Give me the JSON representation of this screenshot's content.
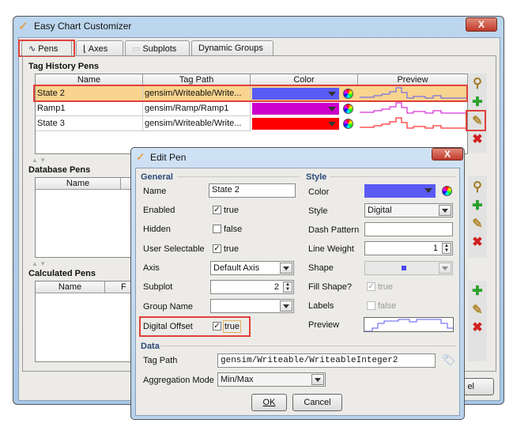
{
  "window": {
    "title": "Easy Chart Customizer",
    "close": "X"
  },
  "tabs": [
    {
      "label": "Pens",
      "icon": "line-chart-icon"
    },
    {
      "label": "Axes",
      "icon": "axes-icon"
    },
    {
      "label": "Subplots",
      "icon": "subplots-icon"
    },
    {
      "label": "Dynamic Groups"
    }
  ],
  "tag_history": {
    "title": "Tag History Pens",
    "columns": [
      "Name",
      "Tag Path",
      "Color",
      "Preview"
    ],
    "rows": [
      {
        "name": "State 2",
        "path": "gensim/Writeable/Write...",
        "color": "#5a5af5",
        "selected": true
      },
      {
        "name": "Ramp1",
        "path": "gensim/Ramp/Ramp1",
        "color": "#cc00cc"
      },
      {
        "name": "State 3",
        "path": "gensim/Writeable/Write...",
        "color": "#ff0000"
      }
    ]
  },
  "database": {
    "title": "Database Pens",
    "columns": [
      "Name"
    ]
  },
  "calculated": {
    "title": "Calculated Pens",
    "columns": [
      "Name",
      "F"
    ]
  },
  "main_cancel": "el",
  "dialog": {
    "title": "Edit Pen",
    "close": "X",
    "general": {
      "title": "General",
      "name_label": "Name",
      "name": "State 2",
      "enabled_label": "Enabled",
      "enabled": "true",
      "hidden_label": "Hidden",
      "hidden": "false",
      "selectable_label": "User Selectable",
      "selectable": "true",
      "axis_label": "Axis",
      "axis": "Default Axis",
      "subplot_label": "Subplot",
      "subplot": "2",
      "group_label": "Group Name",
      "group": "",
      "offset_label": "Digital Offset",
      "offset": "true"
    },
    "style": {
      "title": "Style",
      "color_label": "Color",
      "color": "#5a5af5",
      "style_label": "Style",
      "style": "Digital",
      "dash_label": "Dash Pattern",
      "dash": "",
      "weight_label": "Line Weight",
      "weight": "1",
      "shape_label": "Shape",
      "fill_label": "Fill Shape?",
      "fill": "true",
      "labels_label": "Labels",
      "labels": "false",
      "preview_label": "Preview"
    },
    "data": {
      "title": "Data",
      "path_label": "Tag Path",
      "path": "gensim/Writeable/WriteableInteger2",
      "agg_label": "Aggregation Mode",
      "agg": "Min/Max"
    },
    "ok": "OK",
    "cancel": "Cancel"
  }
}
